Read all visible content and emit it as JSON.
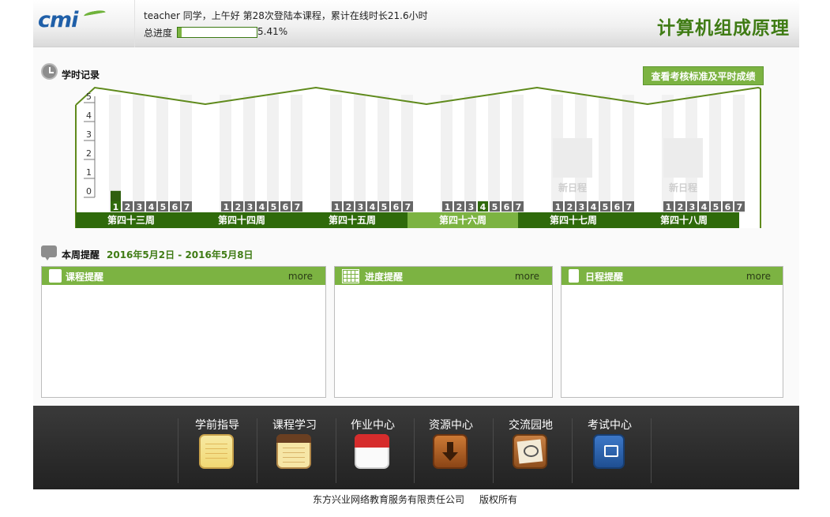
{
  "header": {
    "logo_text": "cmi",
    "greeting": "teacher 同学，上午好  第28次登陆本课程，累计在线时长21.6小时",
    "progress_label": "总进度",
    "progress_fraction": 0.0541,
    "progress_text": "5.41%",
    "course_title": "计算机组成原理"
  },
  "study_record": {
    "title": "学时记录",
    "check_button": "查看考核标准及平时成绩"
  },
  "chart_data": {
    "type": "bar",
    "y_ticks": [
      "0",
      "1",
      "2",
      "3",
      "4",
      "5"
    ],
    "ylim": [
      0,
      5
    ],
    "days": [
      "1",
      "2",
      "3",
      "4",
      "5",
      "6",
      "7"
    ],
    "weeks": [
      {
        "label": "第四十三周",
        "active": false,
        "values": [
          0.55,
          0,
          0,
          0,
          0,
          0,
          0
        ],
        "highlight_day": 0,
        "new_schedule": ""
      },
      {
        "label": "第四十四周",
        "active": false,
        "values": [
          0,
          0,
          0,
          0,
          0,
          0,
          0
        ],
        "highlight_day": -1,
        "new_schedule": ""
      },
      {
        "label": "第四十五周",
        "active": false,
        "values": [
          0,
          0,
          0,
          0,
          0,
          0,
          0
        ],
        "highlight_day": -1,
        "new_schedule": ""
      },
      {
        "label": "第四十六周",
        "active": true,
        "values": [
          0,
          0,
          0,
          0,
          0,
          0,
          0
        ],
        "highlight_day": 3,
        "new_schedule": ""
      },
      {
        "label": "第四十七周",
        "active": false,
        "values": [
          0,
          0,
          0,
          0,
          0,
          0,
          0
        ],
        "highlight_day": -1,
        "new_schedule": "新日程"
      },
      {
        "label": "第四十八周",
        "active": false,
        "values": [
          0,
          0,
          0,
          0,
          0,
          0,
          0
        ],
        "highlight_day": -1,
        "new_schedule": "新日程"
      }
    ],
    "colors": {
      "bar": "#2f5f0f",
      "week_bar": "#2f6a0b",
      "week_active": "#7cb342",
      "day_box": "#666666",
      "day_highlight": "#2f6a0b",
      "outline": "#5f8a1c"
    }
  },
  "reminders": {
    "title": "本周提醒",
    "range_start": "2016年5月2日",
    "range_sep": " - ",
    "range_end": "2016年5月8日",
    "boxes": [
      {
        "title": "课程提醒",
        "more": "more"
      },
      {
        "title": "进度提醒",
        "more": "more"
      },
      {
        "title": "日程提醒",
        "more": "more"
      }
    ]
  },
  "nav": {
    "items": [
      {
        "label": "学前指导",
        "icon": "notepad-icon"
      },
      {
        "label": "课程学习",
        "icon": "notebook-icon"
      },
      {
        "label": "作业中心",
        "icon": "calendar-icon"
      },
      {
        "label": "资源中心",
        "icon": "download-icon"
      },
      {
        "label": "交流园地",
        "icon": "chat-icon"
      },
      {
        "label": "考试中心",
        "icon": "book-icon"
      }
    ]
  },
  "footer": {
    "company": "东方兴业网络教育服务有限责任公司",
    "rights": "版权所有"
  }
}
